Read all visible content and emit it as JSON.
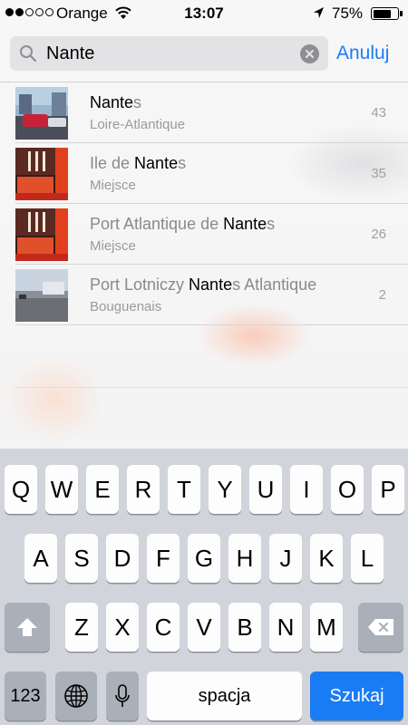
{
  "status_bar": {
    "carrier": "Orange",
    "time": "13:07",
    "battery": "75%",
    "battery_level": 0.75,
    "signal_bars": 2
  },
  "search": {
    "value": "Nante",
    "cancel_label": "Anuluj"
  },
  "results": [
    {
      "title_hl": "Nante",
      "title_pre": "",
      "title_post": "s",
      "subtitle": "Loire-Atlantique",
      "count": "43",
      "thumb": "car-street"
    },
    {
      "title_pre": "Ile de ",
      "title_hl": "Nante",
      "title_post": "s",
      "subtitle": "Miejsce",
      "count": "35",
      "thumb": "red-interior"
    },
    {
      "title_pre": "Port Atlantique de ",
      "title_hl": "Nante",
      "title_post": "s",
      "subtitle": "Miejsce",
      "count": "26",
      "thumb": "red-interior"
    },
    {
      "title_pre": "Port Lotniczy ",
      "title_hl": "Nante",
      "title_post": "s Atlantique",
      "subtitle": "Bouguenais",
      "count": "2",
      "thumb": "airport-road"
    }
  ],
  "keyboard": {
    "row1": [
      "Q",
      "W",
      "E",
      "R",
      "T",
      "Y",
      "U",
      "I",
      "O",
      "P"
    ],
    "row2": [
      "A",
      "S",
      "D",
      "F",
      "G",
      "H",
      "J",
      "K",
      "L"
    ],
    "row3": [
      "Z",
      "X",
      "C",
      "V",
      "B",
      "N",
      "M"
    ],
    "numbers_label": "123",
    "space_label": "spacja",
    "search_label": "Szukaj"
  },
  "colors": {
    "accent": "#1a7cf5",
    "keyboard_bg": "#d1d5db"
  }
}
